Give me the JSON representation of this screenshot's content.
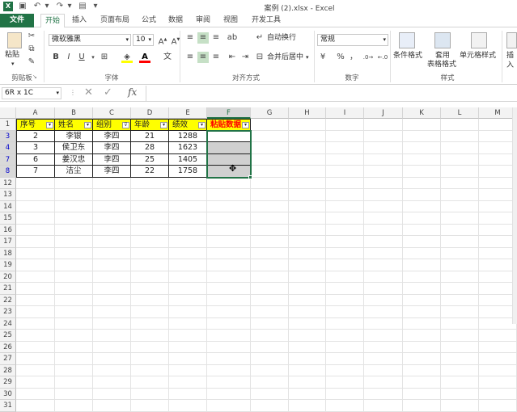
{
  "app": {
    "title": "案例 (2).xlsx - Excel"
  },
  "tabs": [
    "文件",
    "开始",
    "插入",
    "页面布局",
    "公式",
    "数据",
    "审阅",
    "视图",
    "开发工具"
  ],
  "ribbon": {
    "clipboard": {
      "paste": "粘贴",
      "label": "剪贴板"
    },
    "font": {
      "name": "微软雅黑",
      "size": "10",
      "bold": "B",
      "italic": "I",
      "underline": "U",
      "label": "字体"
    },
    "alignment": {
      "wrap": "自动换行",
      "merge": "合并后居中",
      "label": "对齐方式"
    },
    "number": {
      "format": "常规",
      "percent": "%",
      "comma": "，",
      "label": "数字"
    },
    "styles": {
      "conditional": "条件格式",
      "table_line1": "套用",
      "table_line2": "表格格式",
      "cell_styles": "单元格样式",
      "label": "样式"
    },
    "cells": {
      "insert": "插入"
    }
  },
  "formula_bar": {
    "name_box": "6R x 1C",
    "fx": "fx",
    "value": ""
  },
  "columns": [
    "A",
    "B",
    "C",
    "D",
    "E",
    "F",
    "G",
    "H",
    "I",
    "J",
    "K",
    "L",
    "M"
  ],
  "rows": [
    "1",
    "3",
    "4",
    "7",
    "8",
    "12",
    "13",
    "14",
    "15",
    "16",
    "17",
    "18",
    "19",
    "20",
    "21",
    "22",
    "23",
    "24",
    "25",
    "26",
    "27",
    "28",
    "29",
    "30",
    "31"
  ],
  "header": [
    "序号",
    "姓名",
    "组别",
    "年龄",
    "绩效",
    "粘贴数据"
  ],
  "data": [
    [
      "2",
      "李银",
      "李四",
      "21",
      "1288"
    ],
    [
      "3",
      "侯卫东",
      "李四",
      "28",
      "1623"
    ],
    [
      "6",
      "姜汉忠",
      "李四",
      "25",
      "1405"
    ],
    [
      "7",
      "洁尘",
      "李四",
      "22",
      "1758"
    ]
  ],
  "colors": {
    "brand": "#217346",
    "header_fill": "#ffff00",
    "paste_text": "#ff0000",
    "selection_fill": "#d0d0d0",
    "filtered_row": "#0000cc"
  }
}
